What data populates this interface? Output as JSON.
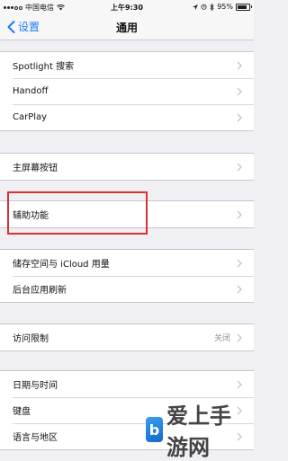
{
  "status_bar": {
    "carrier": "中国电信",
    "time": "上午9:30",
    "battery": "95%"
  },
  "nav": {
    "back_label": "设置",
    "title": "通用"
  },
  "groups": [
    {
      "rows": [
        {
          "label": "Spotlight 搜索"
        },
        {
          "label": "Handoff"
        },
        {
          "label": "CarPlay"
        }
      ]
    },
    {
      "rows": [
        {
          "label": "主屏幕按钮"
        }
      ]
    },
    {
      "rows": [
        {
          "label": "辅助功能"
        }
      ]
    },
    {
      "rows": [
        {
          "label": "储存空间与 iCloud 用量"
        },
        {
          "label": "后台应用刷新"
        }
      ]
    },
    {
      "rows": [
        {
          "label": "访问限制",
          "value": "关闭"
        }
      ]
    },
    {
      "rows": [
        {
          "label": "日期与时间"
        },
        {
          "label": "键盘"
        },
        {
          "label": "语言与地区"
        }
      ]
    }
  ],
  "watermark": {
    "logo_letter": "b",
    "text": "爱上手游网"
  },
  "colors": {
    "accent": "#1a7cf4",
    "highlight": "#d9312f",
    "background": "#efeff4"
  }
}
